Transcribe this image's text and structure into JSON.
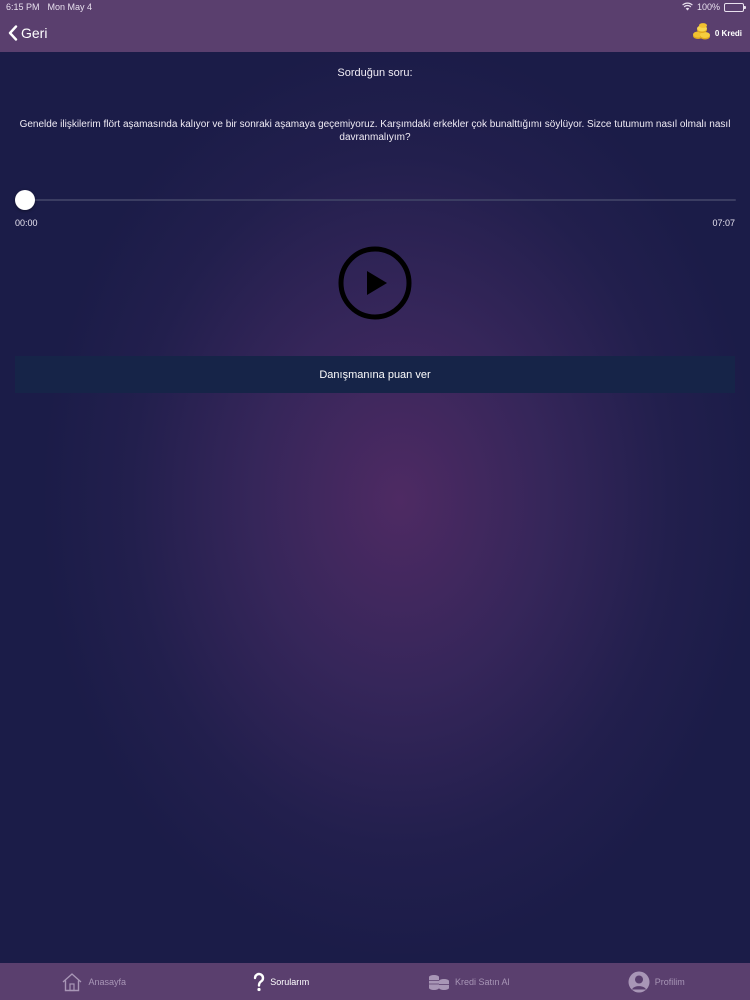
{
  "status_bar": {
    "time": "6:15 PM",
    "date": "Mon May 4",
    "battery": "100%"
  },
  "nav": {
    "back_label": "Geri",
    "credit_label": "0 Kredi"
  },
  "question": {
    "heading": "Sorduğun soru:",
    "text": "Genelde ilişkilerim flört aşamasında kalıyor ve bir sonraki aşamaya geçemiyoruz. Karşımdaki erkekler çok bunalttığımı söylüyor. Sizce tutumum nasıl olmalı nasıl davranmalıyım?"
  },
  "player": {
    "current_time": "00:00",
    "total_time": "07:07",
    "progress": 0
  },
  "rate_button_label": "Danışmanına puan ver",
  "tabs": [
    {
      "label": "Anasayfa",
      "icon": "home-icon",
      "active": false
    },
    {
      "label": "Sorularım",
      "icon": "question-icon",
      "active": true
    },
    {
      "label": "Kredi Satın Al",
      "icon": "coins-icon",
      "active": false
    },
    {
      "label": "Profilim",
      "icon": "user-icon",
      "active": false
    }
  ],
  "colors": {
    "bar": "#5a3f6e",
    "button": "#162448",
    "accent_coin": "#f2c230"
  }
}
